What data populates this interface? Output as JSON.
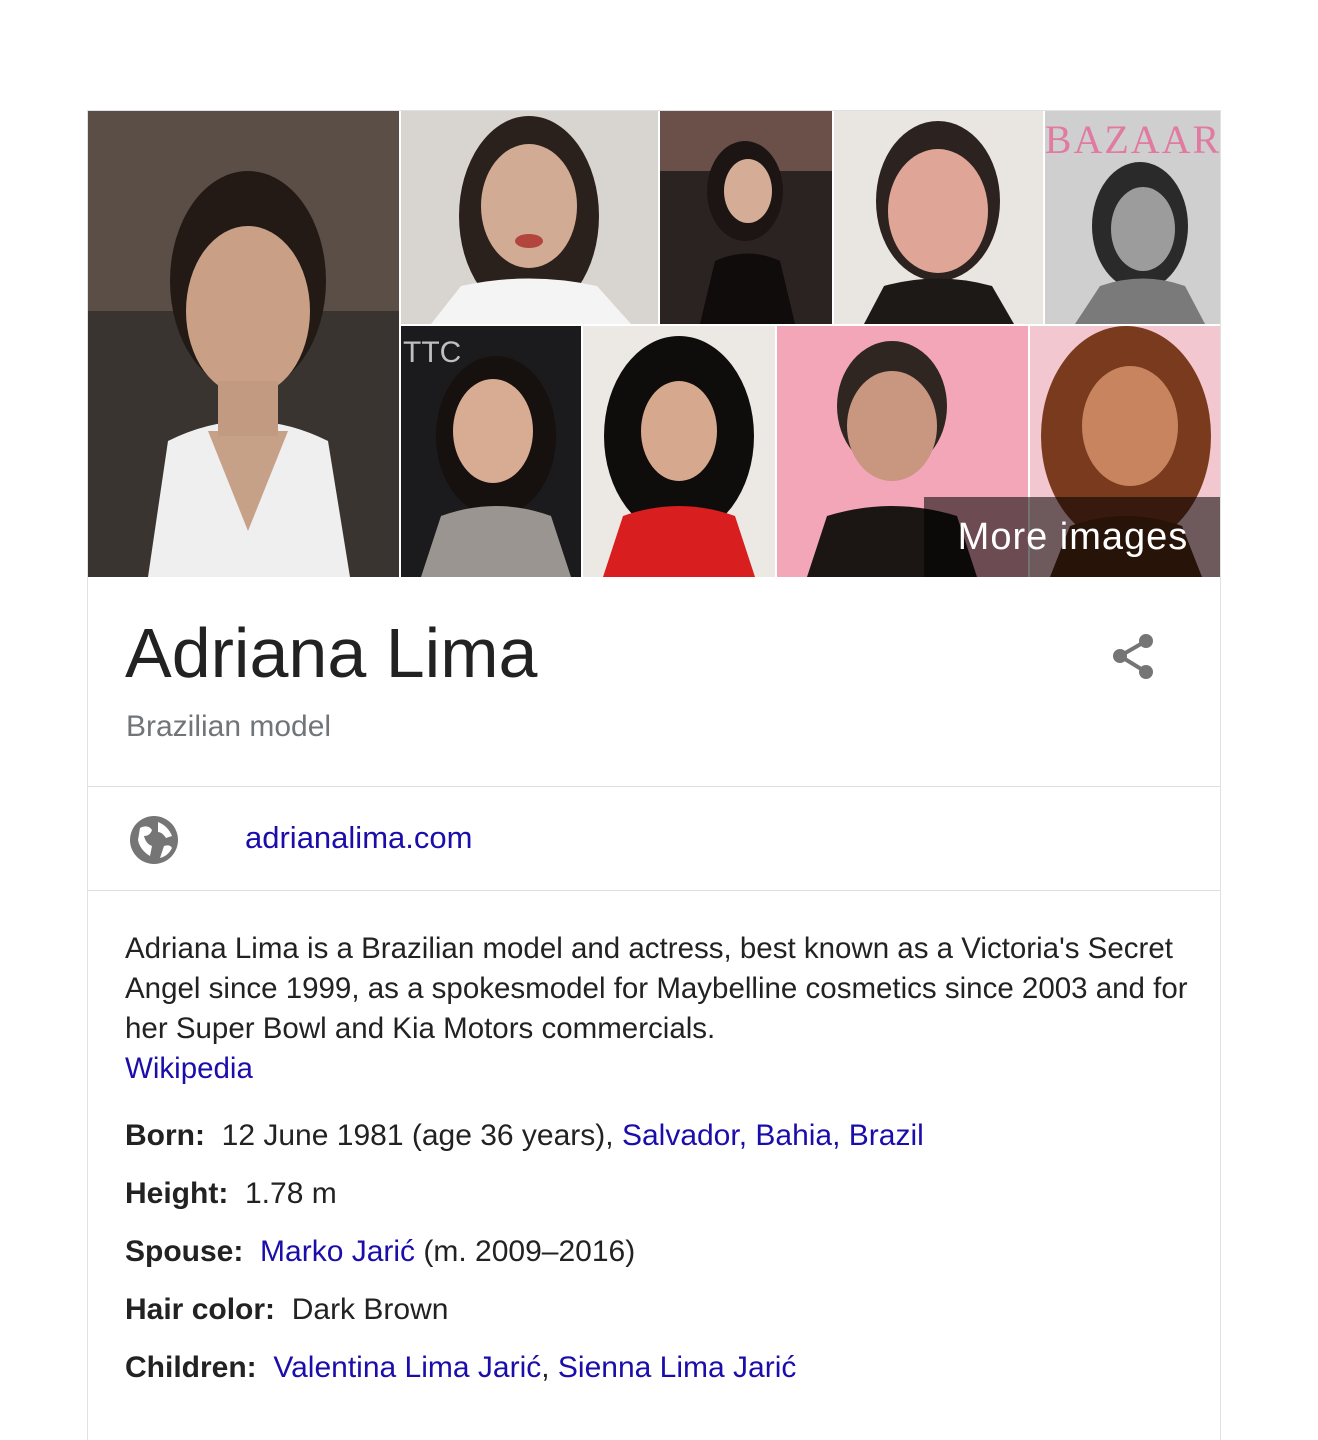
{
  "colors": {
    "link": "#1a0dab",
    "title": "#222222",
    "subtitle": "#70757a",
    "divider": "#e0e0e0",
    "icon": "#757575"
  },
  "gallery": {
    "more_images_label": "More images",
    "tiles": [
      {
        "icon": "photo-red-carpet-portrait"
      },
      {
        "icon": "photo-portrait"
      },
      {
        "icon": "photo-event"
      },
      {
        "icon": "photo-selfie"
      },
      {
        "icon": "photo-magazine-cover",
        "cover_text": "BAZAAR"
      },
      {
        "icon": "photo-event",
        "sign_text": "TTC"
      },
      {
        "icon": "photo-portrait"
      },
      {
        "icon": "photo-selfie"
      },
      {
        "icon": "photo-portrait"
      }
    ]
  },
  "header": {
    "title": "Adriana Lima",
    "subtitle": "Brazilian model",
    "share_icon": "share-icon"
  },
  "website": {
    "icon": "globe-icon",
    "label": "adrianalima.com"
  },
  "description": {
    "text": "Adriana Lima is a Brazilian model and actress, best known as a Victoria's Secret Angel since 1999, as a spokesmodel for Maybelline cosmetics since 2003 and for her Super Bowl and Kia Motors commercials.",
    "source_label": "Wikipedia"
  },
  "facts": {
    "born": {
      "label": "Born:",
      "value": "12 June 1981 (age 36 years), ",
      "link": "Salvador, Bahia, Brazil"
    },
    "height": {
      "label": "Height:",
      "value": "1.78 m"
    },
    "spouse": {
      "label": "Spouse:",
      "link": "Marko Jarić",
      "value": " (m. 2009–2016)"
    },
    "hair_color": {
      "label": "Hair color:",
      "value": "Dark Brown"
    },
    "children": {
      "label": "Children:",
      "link1": "Valentina Lima Jarić",
      "separator": ", ",
      "link2": "Sienna Lima Jarić"
    }
  }
}
